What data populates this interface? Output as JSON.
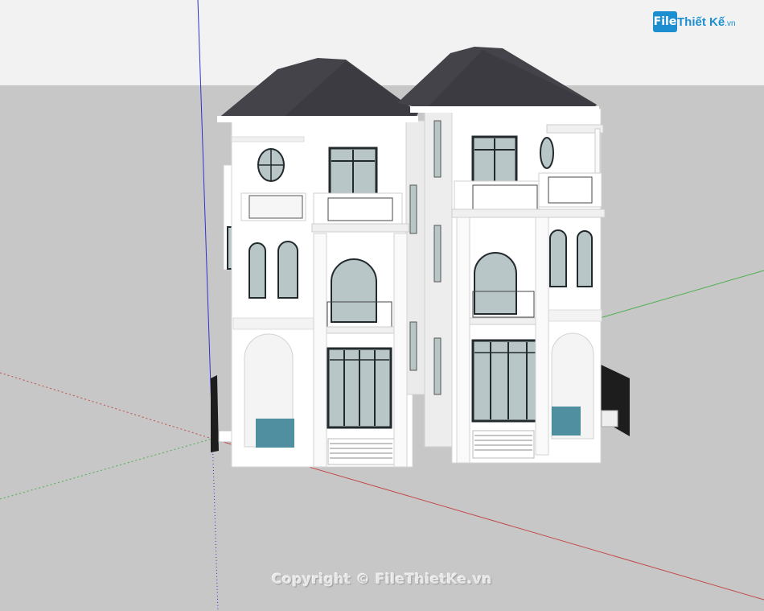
{
  "logo": {
    "badge": "File",
    "name": "Thiết Kế",
    "domain": ".vn"
  },
  "watermark": "Copyright © FileThietKe.vn",
  "scene": {
    "axes": {
      "red": "#c44b4b",
      "green": "#4caf50",
      "blue": "#3333cc"
    },
    "colors": {
      "roof": "#45434a",
      "wall": "#ffffff",
      "shadow": "#e3e3e3",
      "glass": "#b9c6c8",
      "frame": "#222a2e",
      "pool": "#4f8fa0",
      "gate": "#1d1d1d",
      "sky": "#f2f2f2",
      "ground": "#c7c7c7"
    }
  }
}
